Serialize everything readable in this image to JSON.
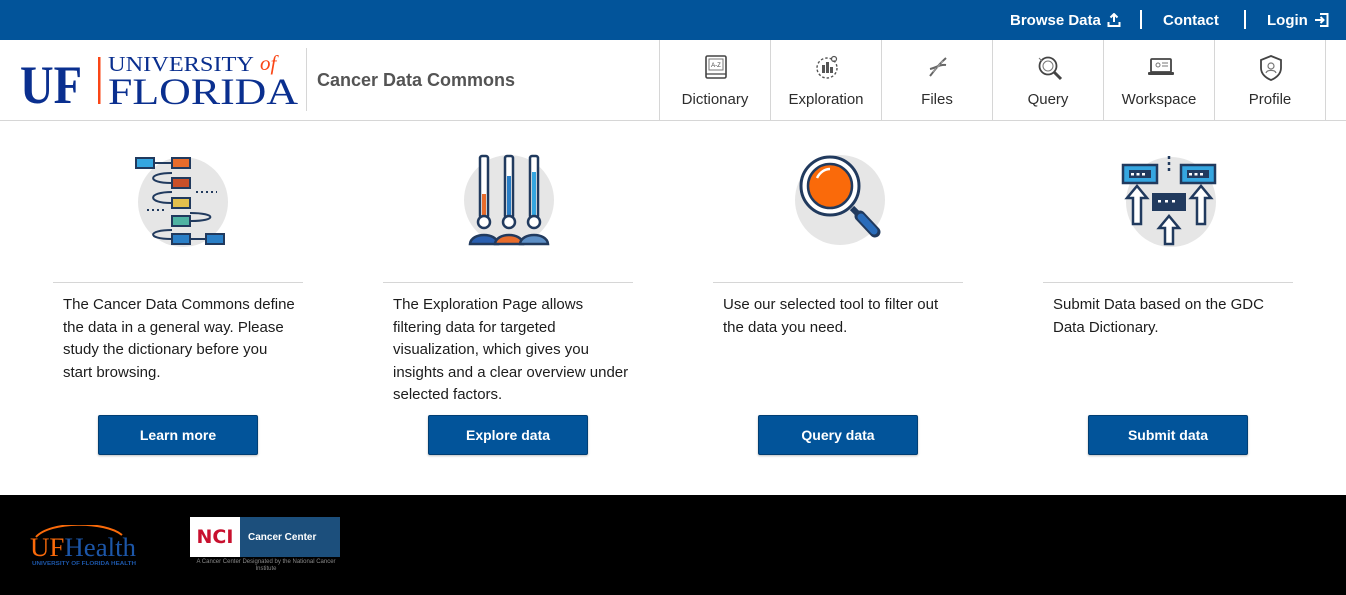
{
  "topbar": {
    "browse_label": "Browse Data",
    "contact_label": "Contact",
    "login_label": "Login"
  },
  "header": {
    "logo_text_uf": "UF",
    "logo_text_university": "UNIVERSITY",
    "logo_text_of": "of",
    "logo_text_florida": "FLORIDA",
    "brand_title": "Cancer Data Commons"
  },
  "nav": {
    "items": [
      {
        "label": "Dictionary",
        "icon": "dictionary-book-icon"
      },
      {
        "label": "Exploration",
        "icon": "exploration-icon"
      },
      {
        "label": "Files",
        "icon": "files-dna-icon"
      },
      {
        "label": "Query",
        "icon": "query-magnifier-icon"
      },
      {
        "label": "Workspace",
        "icon": "workspace-laptop-icon"
      },
      {
        "label": "Profile",
        "icon": "profile-shield-icon"
      }
    ]
  },
  "cards": [
    {
      "description": "The Cancer Data Commons define the data in a general way. Please study the dictionary before you start browsing.",
      "button_label": "Learn more",
      "icon": "flowchart-icon"
    },
    {
      "description": "The Exploration Page allows filtering data for targeted visualization, which gives you insights and a clear overview under selected factors.",
      "button_label": "Explore data",
      "icon": "people-bars-icon"
    },
    {
      "description": "Use our selected tool to filter out the data you need.",
      "button_label": "Query data",
      "icon": "magnifying-glass-icon"
    },
    {
      "description": "Submit Data based on the GDC Data Dictionary.",
      "button_label": "Submit data",
      "icon": "upload-data-icon"
    }
  ],
  "footer": {
    "ufhealth_text": "UFHealth",
    "ufhealth_sub": "UNIVERSITY OF FLORIDA HEALTH",
    "nci_label": "NCI",
    "nci_center": "Cancer Center",
    "nci_sub": "A Cancer Center Designated by the National Cancer Institute"
  },
  "colors": {
    "primary_blue": "#02549a",
    "accent_orange": "#fa6a0a",
    "footer_bg": "#000000"
  }
}
